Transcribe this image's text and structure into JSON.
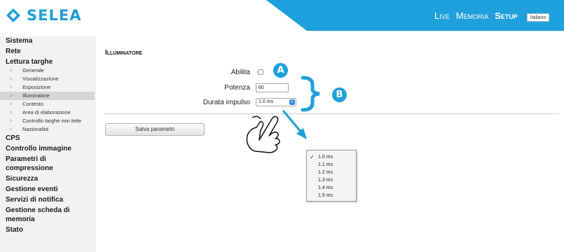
{
  "header": {
    "logo_text": "SELEA",
    "nav": [
      {
        "label": "Live"
      },
      {
        "label": "Memoria"
      },
      {
        "label": "Setup"
      }
    ],
    "language": "Italiano",
    "accent_color": "#1ea0dc"
  },
  "sidebar": {
    "items": [
      {
        "label": "Sistema"
      },
      {
        "label": "Rete"
      },
      {
        "label": "Lettura targhe"
      }
    ],
    "lettura_sub": [
      {
        "label": "Generale"
      },
      {
        "label": "Visualizzazione"
      },
      {
        "label": "Esposizione"
      },
      {
        "label": "Illuminatore"
      },
      {
        "label": "Contesto"
      },
      {
        "label": "Area di elaborazione"
      },
      {
        "label": "Controllo targhe non lette"
      },
      {
        "label": "Nazionalità"
      }
    ],
    "items_after": [
      {
        "label": "CPS"
      },
      {
        "label": "Controllo immagine"
      },
      {
        "label": "Parametri di compressione"
      },
      {
        "label": "Sicurezza"
      },
      {
        "label": "Gestione eventi"
      },
      {
        "label": "Servizi di notifica"
      },
      {
        "label": "Gestione scheda di memoria"
      },
      {
        "label": "Stato"
      }
    ]
  },
  "main": {
    "title": "Illuminatore",
    "fields": {
      "abilita_label": "Abilita",
      "abilita_checked": false,
      "potenza_label": "Potenza",
      "potenza_value": "60",
      "durata_label": "Durata impulso",
      "durata_value": "1.0 ms"
    },
    "save_label": "Salva parametri"
  },
  "dropdown": {
    "options": [
      "1.0 ms",
      "1.1 ms",
      "1.2 ms",
      "1.3 ms",
      "1.4 ms",
      "1.5 ms"
    ],
    "selected": "1.0 ms",
    "check_glyph": "✓"
  },
  "annotations": {
    "badge_a": "A",
    "badge_b": "B",
    "icons": [
      "hand-pointer-icon",
      "arrow-icon",
      "curly-brace-icon"
    ]
  }
}
